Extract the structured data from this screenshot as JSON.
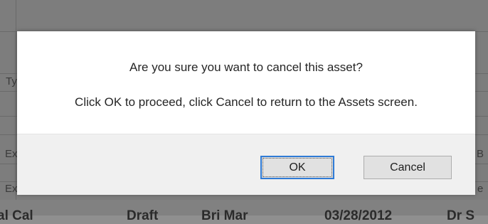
{
  "background_table": {
    "row_fragments": [
      "Ty",
      "Ex",
      "Ex"
    ],
    "right_fragments": [
      "B",
      "e"
    ],
    "bottom_row": [
      "al Cal",
      "Draft",
      "Bri  Mar",
      "03/28/2012",
      "Dr S"
    ]
  },
  "dialog": {
    "question": "Are you sure you want to cancel this asset?",
    "instruction": "Click OK to proceed, click Cancel to return to the Assets screen.",
    "ok_label": "OK",
    "cancel_label": "Cancel"
  },
  "colors": {
    "overlay": "#7d7d7d",
    "dialog_bg": "#ffffff",
    "footer_bg": "#f0f0f0",
    "button_bg": "#e1e1e1",
    "focus_border": "#2f7bd6"
  }
}
